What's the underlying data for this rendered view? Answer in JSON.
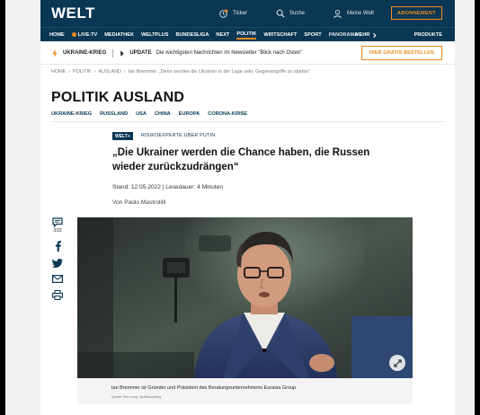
{
  "header": {
    "logo": "WELT",
    "ticker_label": "Ticker",
    "search_label": "Suche",
    "account_label": "Meine Welt",
    "abo_button": "ABONNEMENT"
  },
  "nav": {
    "items": [
      "HOME",
      "LIVE-TV",
      "MEDIATHEK",
      "WELTPLUS",
      "BUNDESLIGA",
      "NEXT",
      "POLITIK",
      "WIRTSCHAFT",
      "SPORT",
      "PANORAMA"
    ],
    "active": "POLITIK",
    "more": "MEHR",
    "produkte": "PRODUKTE"
  },
  "ticker": {
    "tag": "UKRAINE-KRIEG",
    "update_label": "UPDATE",
    "update_text": "Die wichtigsten Nachrichten im Newsletter \"Blick nach Osten\"",
    "order_button": "HIER GRATIS BESTELLEN"
  },
  "breadcrumb": [
    "HOME",
    "POLITIK",
    "AUSLAND",
    "Ian Bremmer: „Denn werden die Ukrainer in der Lage sein, Gegenangriffe zu starten“"
  ],
  "section": {
    "title": "POLITIK AUSLAND",
    "subnav": [
      "UKRAINE-KRIEG",
      "RUSSLAND",
      "USA",
      "CHINA",
      "EUROPA",
      "CORONA-KRISE"
    ]
  },
  "article": {
    "badge": "WELT+",
    "kicker": "RISIKOEXPERTE ÜBER PUTIN",
    "headline": "„Die Ukrainer werden die Chance haben, die Russen wieder zurückzudrängen“",
    "meta": "Stand: 12.05.2022 | Lesedauer: 4 Minuten",
    "author": "Von Paolo Mastrolilli",
    "comment_count": "333",
    "caption": "Ian Bremmer ist Gründer und Präsident des Beratungsunternehmens Eurasia Group",
    "credit": "Quelle: Wei Leng Tay/Bloomberg"
  },
  "colors": {
    "brand_navy": "#0a3753",
    "accent_orange": "#f08a1e"
  }
}
